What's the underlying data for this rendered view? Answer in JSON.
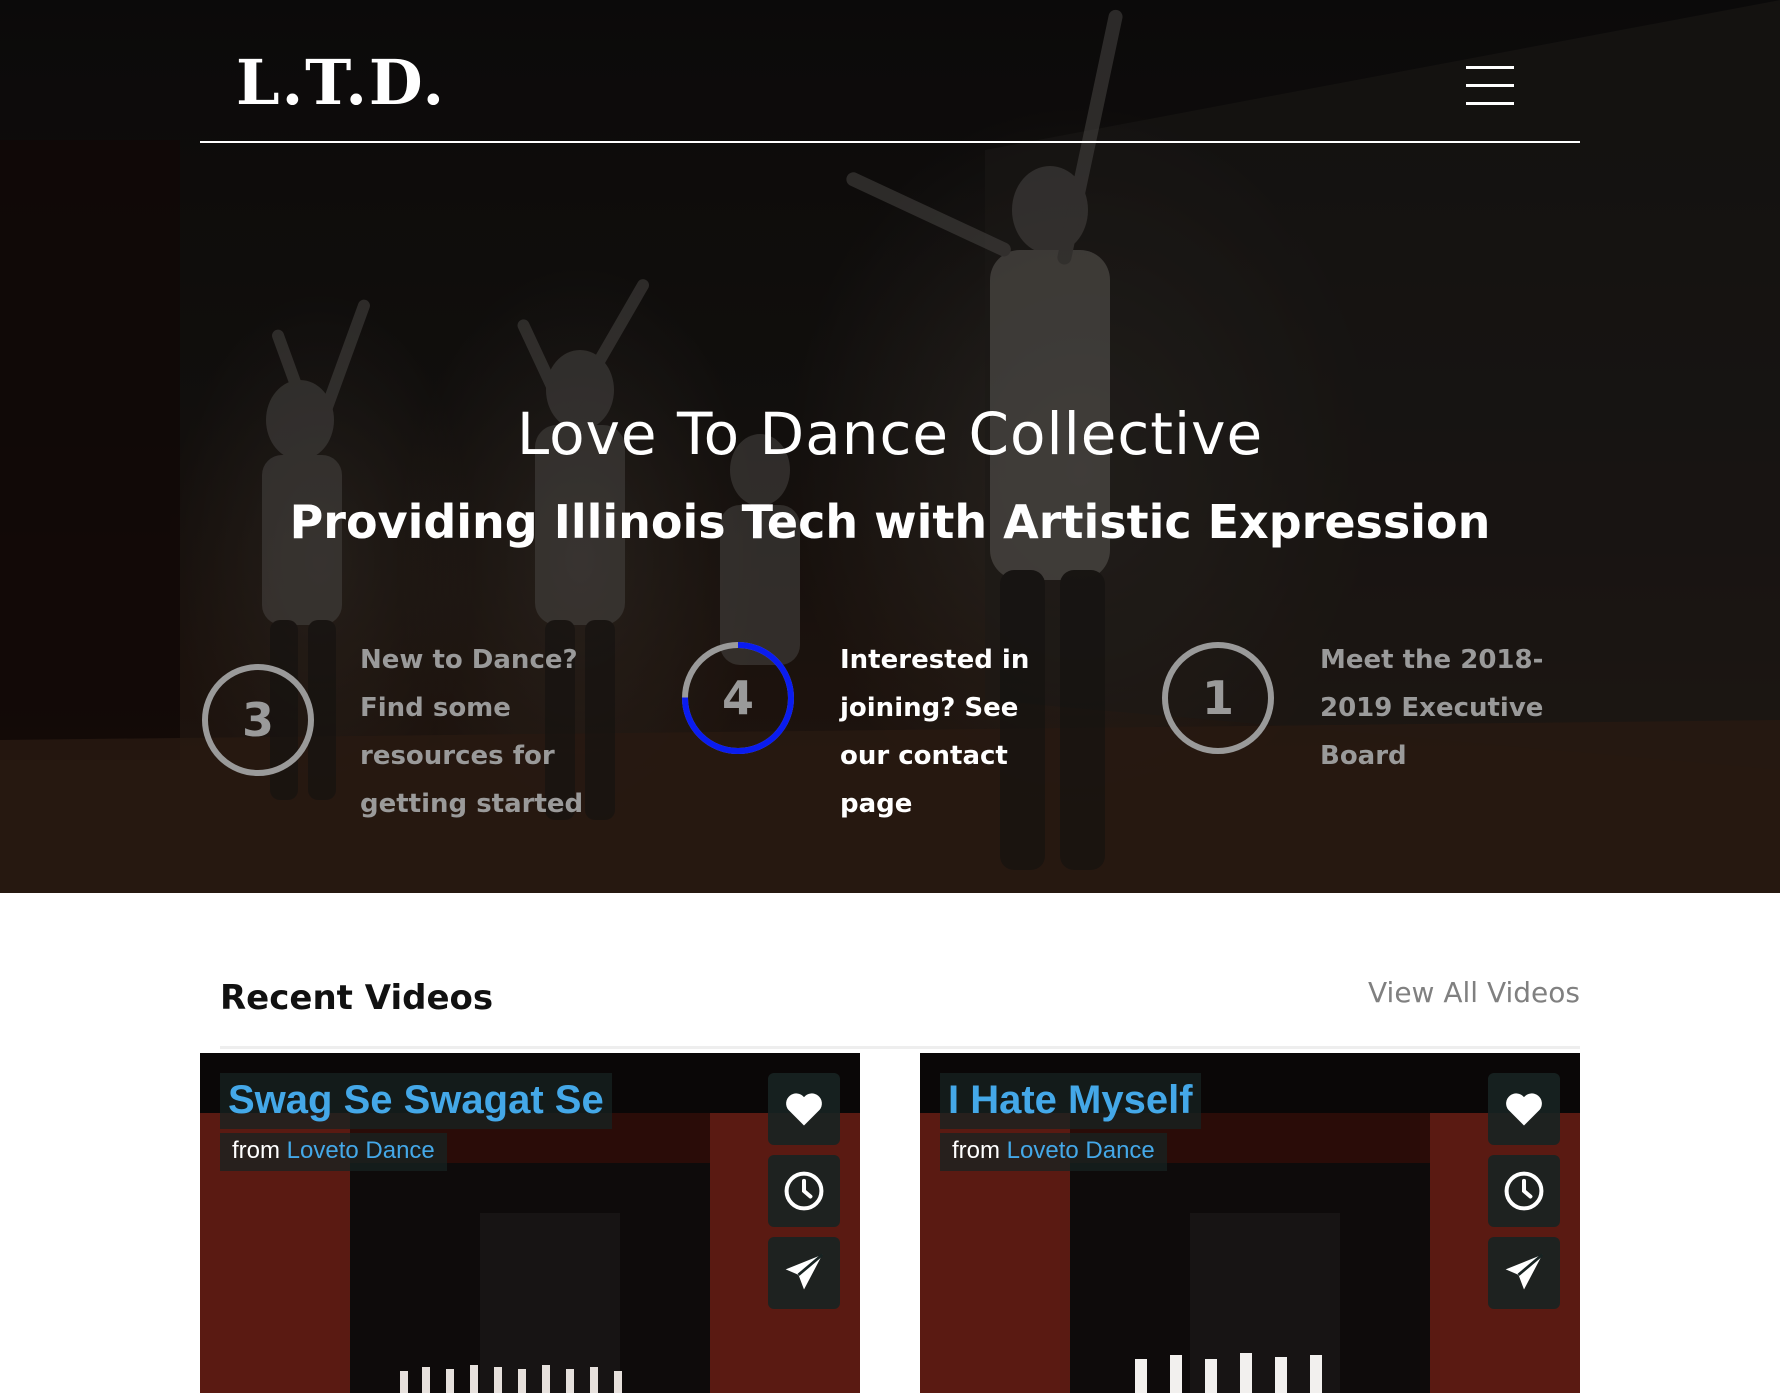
{
  "header": {
    "logo_text": "L.T.D.",
    "menu_icon": "hamburger-menu-icon"
  },
  "hero": {
    "title": "Love To Dance Collective",
    "subtitle": "Providing Illinois Tech with Artistic Expression",
    "features": [
      {
        "number": "3",
        "text": "New to Dance? Find some resources for getting started",
        "active": false
      },
      {
        "number": "4",
        "text": "Interested in joining? See our contact page",
        "active": true
      },
      {
        "number": "1",
        "text": "Meet the 2018-2019 Executive Board",
        "active": false
      }
    ],
    "colors": {
      "active_ring": "#0a1cf0",
      "inactive_ring": "#9a9a9a",
      "active_text": "#ffffff",
      "inactive_text": "#9a9a9a"
    }
  },
  "videos": {
    "section_title": "Recent Videos",
    "view_all_label": "View All Videos",
    "items": [
      {
        "title": "Swag Se Swagat Se",
        "from_label": "from",
        "channel": "Loveto Dance"
      },
      {
        "title": "I Hate Myself",
        "from_label": "from",
        "channel": "Loveto Dance"
      }
    ],
    "actions": [
      "heart-icon",
      "clock-icon",
      "paper-plane-icon"
    ],
    "colors": {
      "title_blue": "#44a8e8",
      "overlay_bg": "#172322"
    }
  }
}
